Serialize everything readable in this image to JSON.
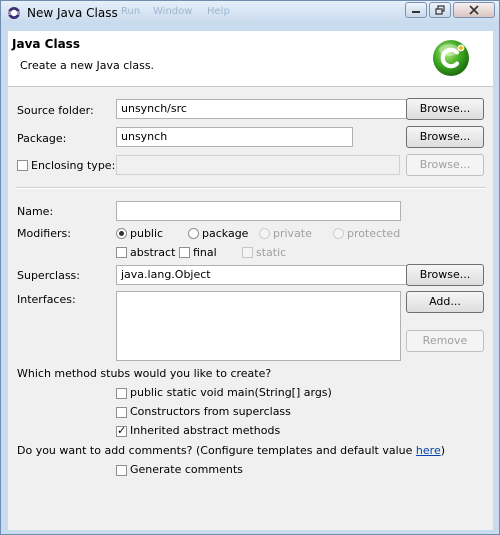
{
  "window": {
    "title": "New Java Class",
    "ghost_menu": [
      "Run",
      "Window",
      "Help"
    ]
  },
  "header": {
    "title": "Java Class",
    "description": "Create a new Java class."
  },
  "form": {
    "source_folder": {
      "label": "Source folder:",
      "value": "unsynch/src",
      "button": "Browse..."
    },
    "package": {
      "label": "Package:",
      "value": "unsynch",
      "button": "Browse..."
    },
    "enclosing_type": {
      "label": "Enclosing type:",
      "value": "",
      "checked": false,
      "button": "Browse..."
    },
    "name": {
      "label": "Name:",
      "value": ""
    },
    "modifiers": {
      "label": "Modifiers:",
      "visibility": [
        {
          "label": "public",
          "selected": true,
          "enabled": true
        },
        {
          "label": "package",
          "selected": false,
          "enabled": true
        },
        {
          "label": "private",
          "selected": false,
          "enabled": false
        },
        {
          "label": "protected",
          "selected": false,
          "enabled": false
        }
      ],
      "flags": [
        {
          "label": "abstract",
          "checked": false,
          "enabled": true
        },
        {
          "label": "final",
          "checked": false,
          "enabled": true
        },
        {
          "label": "static",
          "checked": false,
          "enabled": false
        }
      ]
    },
    "superclass": {
      "label": "Superclass:",
      "value": "java.lang.Object",
      "button": "Browse..."
    },
    "interfaces": {
      "label": "Interfaces:",
      "add_button": "Add...",
      "remove_button": "Remove",
      "items": []
    }
  },
  "stubs": {
    "question": "Which method stubs would you like to create?",
    "options": [
      {
        "label": "public static void main(String[] args)",
        "checked": false
      },
      {
        "label": "Constructors from superclass",
        "checked": false
      },
      {
        "label": "Inherited abstract methods",
        "checked": true
      }
    ]
  },
  "comments": {
    "question_prefix": "Do you want to add comments? (Configure templates and default value ",
    "link": "here",
    "question_suffix": ")",
    "option": {
      "label": "Generate comments",
      "checked": false
    }
  },
  "colors": {
    "title_bar": "#c6d9ee",
    "content_bg": "#f0f0f0",
    "link": "#0645ad",
    "logo_green": "#3aa61f"
  },
  "icons": {
    "window_icon": "eclipse-java-icon",
    "header_logo": "new-class-c-icon",
    "check_mark": "✓"
  }
}
